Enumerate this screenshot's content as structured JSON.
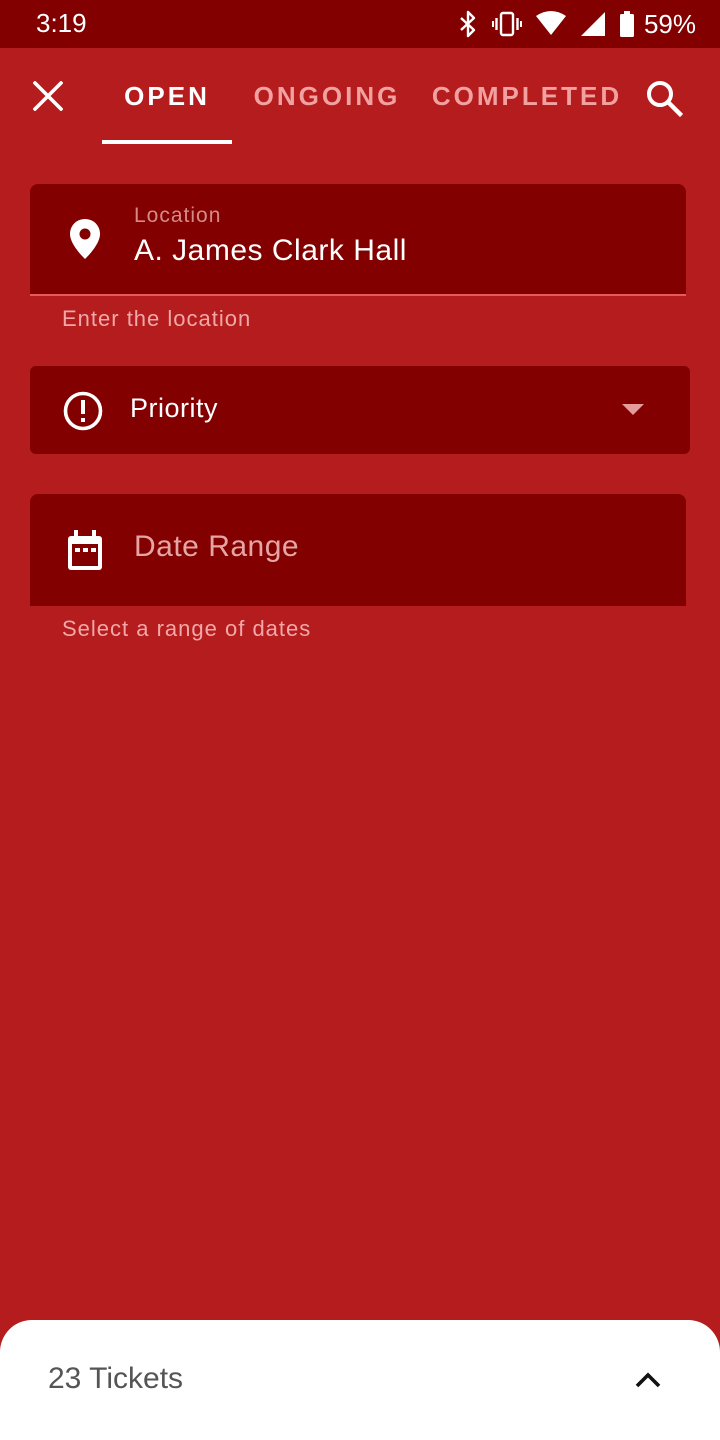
{
  "status_bar": {
    "time": "3:19",
    "battery_percent": "59%",
    "icons": [
      "bluetooth-icon",
      "vibrate-icon",
      "wifi-icon",
      "cell-signal-icon",
      "battery-icon"
    ]
  },
  "app_bar": {
    "close_icon": "close-icon",
    "search_icon": "search-icon",
    "tabs": [
      {
        "label": "OPEN",
        "selected": true
      },
      {
        "label": "ONGOING",
        "selected": false
      },
      {
        "label": "COMPLETED",
        "selected": false
      }
    ]
  },
  "form": {
    "location": {
      "label": "Location",
      "value": "A. James Clark Hall",
      "helper": "Enter the location",
      "icon": "location-pin-icon"
    },
    "priority": {
      "label": "Priority",
      "icon": "priority-alert-icon"
    },
    "date_range": {
      "placeholder": "Date Range",
      "helper": "Select a range of dates",
      "icon": "calendar-icon"
    }
  },
  "bottom_sheet": {
    "label": "23 Tickets",
    "icon": "chevron-up-icon"
  },
  "colors": {
    "background": "#b41c1d",
    "field_background": "#820000",
    "status_bar": "#820000",
    "sheet": "#ffffff"
  }
}
